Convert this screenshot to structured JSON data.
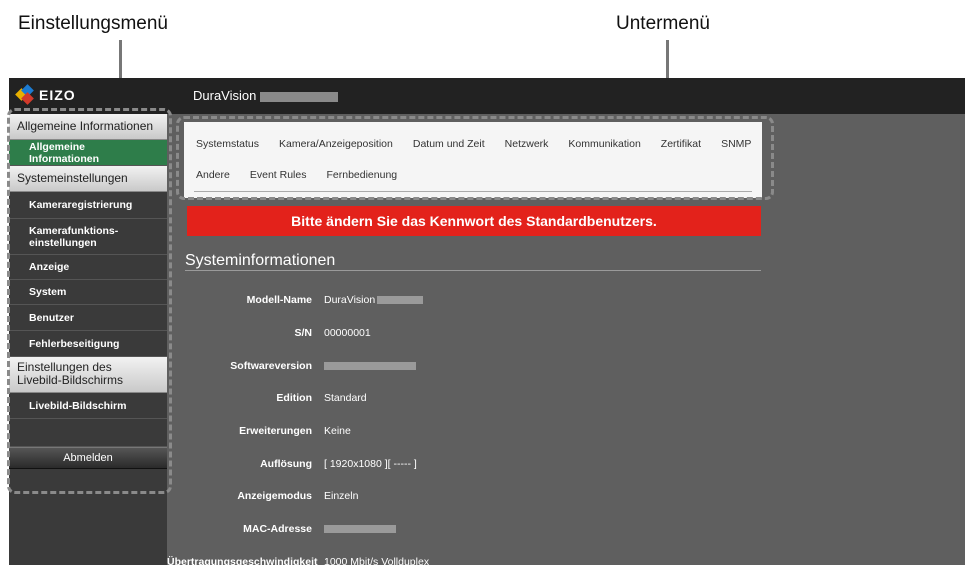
{
  "callouts": {
    "left": "Einstellungsmenü",
    "right": "Untermenü"
  },
  "brand": {
    "logo_text": "EIZO",
    "device_name": "DuraVision"
  },
  "sidebar": {
    "sections": [
      {
        "header": "Allgemeine Informationen",
        "items": [
          "Allgemeine Informationen"
        ]
      },
      {
        "header": "Systemeinstellungen",
        "items": [
          "Kameraregistrierung",
          "Kamerafunktions-\neinstellungen",
          "Anzeige",
          "System",
          "Benutzer",
          "Fehlerbeseitigung"
        ]
      },
      {
        "header": "Einstellungen des Livebild-Bildschirms",
        "items": [
          "Livebild-Bildschirm"
        ]
      }
    ],
    "active_item": "Allgemeine Informationen",
    "logout": "Abmelden"
  },
  "submenu": {
    "row1": [
      "Systemstatus",
      "Kamera/Anzeigeposition",
      "Datum und Zeit",
      "Netzwerk",
      "Kommunikation",
      "Zertifikat",
      "SNMP"
    ],
    "row2": [
      "Andere",
      "Event Rules",
      "Fernbedienung"
    ]
  },
  "alert": "Bitte ändern Sie das Kennwort des Standardbenutzers.",
  "section_title": "Systeminformationen",
  "info": {
    "model_label": "Modell-Name",
    "model_value": "DuraVision",
    "sn_label": "S/N",
    "sn_value": "00000001",
    "sw_label": "Softwareversion",
    "edition_label": "Edition",
    "edition_value": "Standard",
    "ext_label": "Erweiterungen",
    "ext_value": "Keine",
    "res_label": "Auflösung",
    "res_value": "[ 1920x1080 ][ ----- ]",
    "mode_label": "Anzeigemodus",
    "mode_value": "Einzeln",
    "mac_label": "MAC-Adresse",
    "speed_label": "Übertragungsgeschwindigkeit",
    "speed_value": "1000 Mbit/s Vollduplex"
  },
  "colors": {
    "accent_green": "#2e7d4a",
    "alert_red": "#e3221b",
    "topbar": "#222222"
  }
}
